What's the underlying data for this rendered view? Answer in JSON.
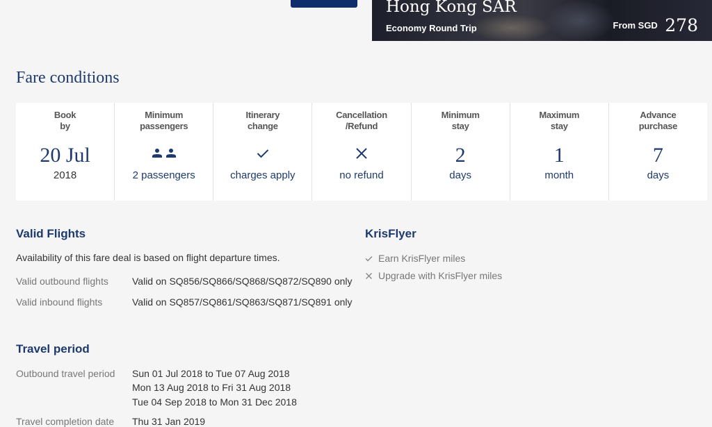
{
  "hero": {
    "city": "Hong Kong SAR",
    "trip_type": "Economy Round Trip",
    "from_label": "From SGD",
    "price": "278"
  },
  "fare_conditions": {
    "title": "Fare conditions",
    "items": [
      {
        "label": "Book\nby",
        "value": "20 Jul",
        "sub": "2018"
      },
      {
        "label": "Minimum\npassengers",
        "icon": "two-person-icon",
        "sub": "2 passengers"
      },
      {
        "label": "Itinerary\nchange",
        "icon": "check-icon",
        "sub": "charges apply"
      },
      {
        "label": "Cancellation\n/Refund",
        "icon": "cross-icon",
        "sub": "no refund"
      },
      {
        "label": "Minimum\nstay",
        "value": "2",
        "sub": "days"
      },
      {
        "label": "Maximum\nstay",
        "value": "1",
        "sub": "month"
      },
      {
        "label": "Advance\npurchase",
        "value": "7",
        "sub": "days"
      }
    ]
  },
  "valid_flights": {
    "title": "Valid Flights",
    "note": "Availability of this fare deal is based on flight departure times.",
    "outbound_label": "Valid outbound flights",
    "outbound_value": "Valid on SQ856/SQ866/SQ868/SQ872/SQ890 only",
    "inbound_label": "Valid inbound flights",
    "inbound_value": "Valid on SQ857/SQ861/SQ863/SQ871/SQ891 only"
  },
  "krisflyer": {
    "title": "KrisFlyer",
    "items": [
      {
        "icon": "check-icon",
        "label": "Earn KrisFlyer miles"
      },
      {
        "icon": "cross-icon",
        "label": "Upgrade with KrisFlyer miles"
      }
    ]
  },
  "travel_period": {
    "title": "Travel period",
    "outbound_label": "Outbound travel period",
    "outbound_periods": [
      "Sun 01 Jul 2018 to Tue 07 Aug 2018",
      "Mon 13 Aug 2018 to Fri 31 Aug 2018",
      "Tue 04 Sep 2018 to Mon 31 Dec 2018"
    ],
    "completion_label": "Travel completion date",
    "completion_value": "Thu 31 Jan 2019"
  },
  "colors": {
    "brand_navy": "#1d3a6e",
    "button_navy": "#0d2e6b",
    "background": "#f5f5f5"
  }
}
